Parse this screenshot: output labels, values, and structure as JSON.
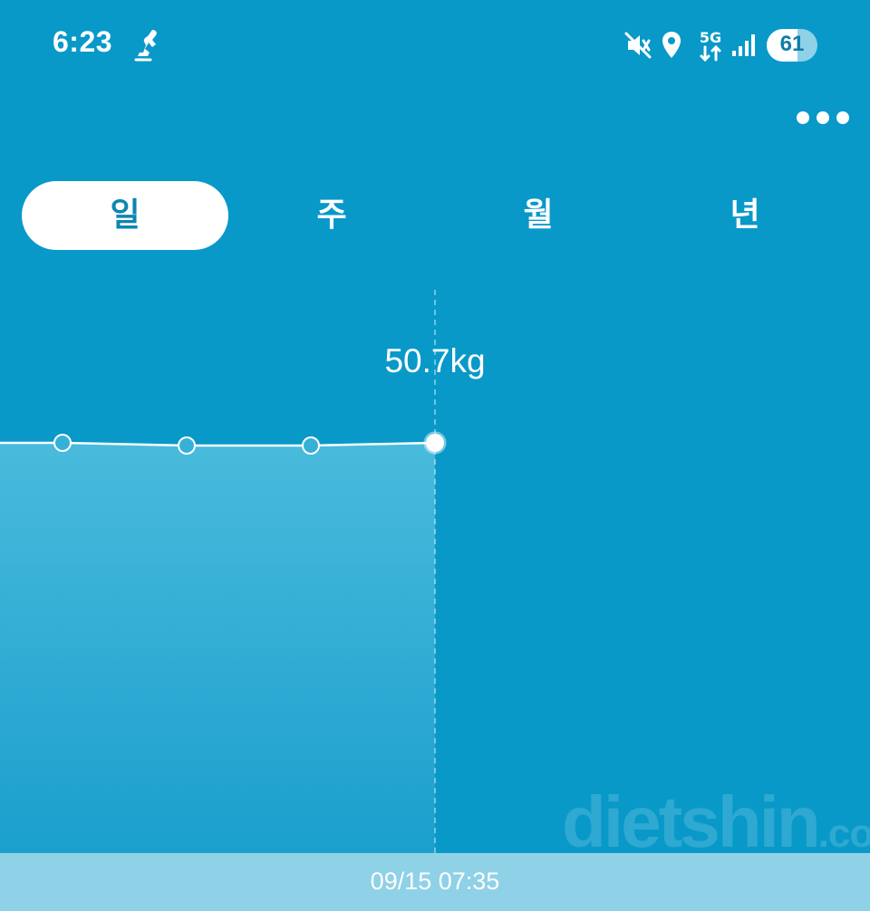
{
  "status_bar": {
    "time": "6:23",
    "network": "5G",
    "battery": "61",
    "battery_level_percent": 61,
    "icons": [
      "run-notification-icon",
      "mute-vibrate-icon",
      "location-icon",
      "5g-data-icon",
      "signal-icon",
      "battery-icon"
    ]
  },
  "header": {
    "more_icon": "more-dots-icon"
  },
  "tabs": [
    {
      "label": "일",
      "active": true
    },
    {
      "label": "주",
      "active": false
    },
    {
      "label": "월",
      "active": false
    },
    {
      "label": "년",
      "active": false
    }
  ],
  "selected": {
    "value": "50.7kg",
    "timestamp": "09/15 07:35"
  },
  "chart_data": {
    "type": "area",
    "series_unit": "kg",
    "points": [
      {
        "index": 0,
        "value": 50.7
      },
      {
        "index": 1,
        "value": 50.7
      },
      {
        "index": 2,
        "value": 50.6
      },
      {
        "index": 3,
        "value": 50.6
      },
      {
        "index": 4,
        "value": 50.7
      }
    ],
    "selected_index": 4,
    "grid": false,
    "line_color": "#ffffff",
    "fill_color": "#45b8da"
  },
  "watermark": {
    "text": "dietshin",
    "suffix": ".com"
  },
  "colors": {
    "background": "#0899c9",
    "active_tab_text": "#0d86b3",
    "time_bar": "#8fd1e6"
  }
}
